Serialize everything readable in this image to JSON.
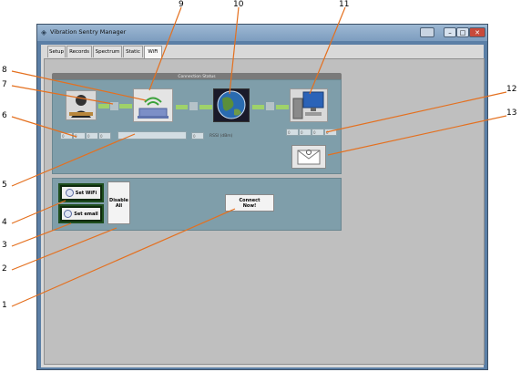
{
  "window": {
    "title": "Vibration Sentry Manager",
    "app_icon": "app-icon"
  },
  "tabs": [
    {
      "label": "Setup",
      "active": false
    },
    {
      "label": "Records",
      "active": false
    },
    {
      "label": "Spectrum",
      "active": false
    },
    {
      "label": "Static",
      "active": false
    },
    {
      "label": "WiFi",
      "active": true
    }
  ],
  "connection_status": {
    "title": "Connection Status",
    "rssi_label": "RSSI (dBm)",
    "devices": [
      "person-icon",
      "router-icon",
      "globe-icon",
      "computer-icon",
      "email-icon"
    ]
  },
  "buttons": {
    "set_wifi": "Set WiFi",
    "set_email": "Set email",
    "disable_all": "Disable All",
    "connect_now": "Connect Now!"
  },
  "callouts": [
    "1",
    "2",
    "3",
    "4",
    "5",
    "6",
    "7",
    "8",
    "9",
    "10",
    "11",
    "12",
    "13"
  ],
  "colors": {
    "link_green": "#9fd26a",
    "panel": "#7f9eaa",
    "close": "#c74a3b"
  }
}
